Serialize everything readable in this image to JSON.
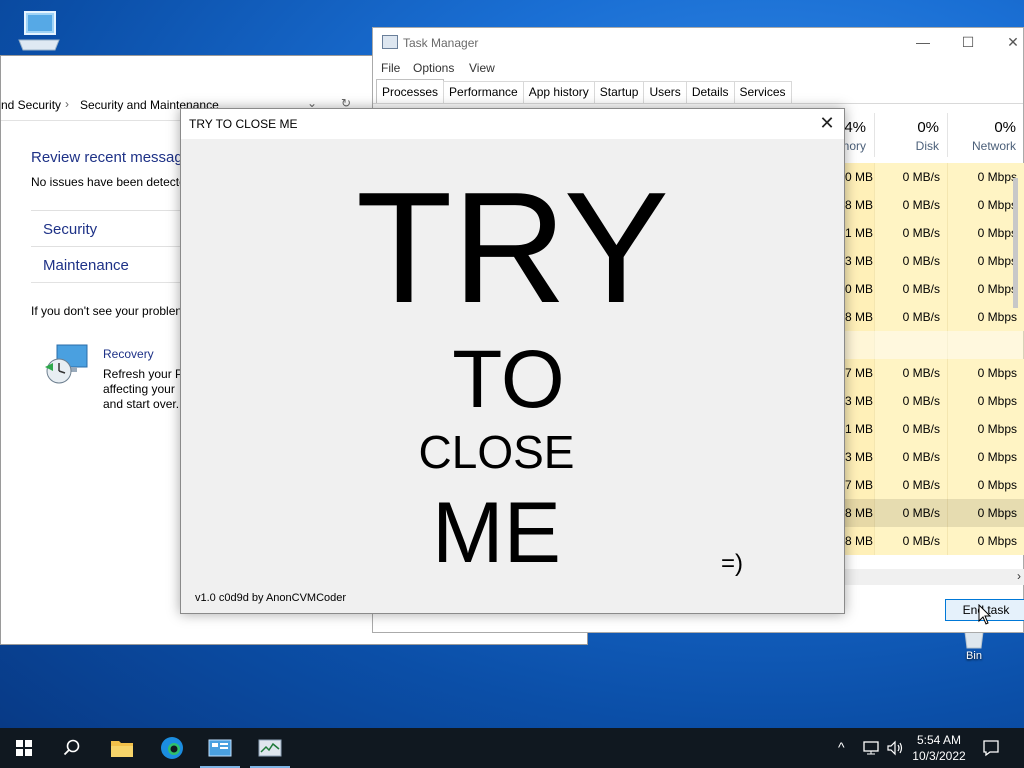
{
  "desktop": {
    "recycle_bin_label": "Bin"
  },
  "control_panel": {
    "breadcrumb": [
      "nd Security",
      "Security and Maintenance"
    ],
    "heading": "Review recent messag",
    "status": "No issues have been detecte",
    "sections": [
      "Security",
      "Maintenance"
    ],
    "note": "If you don't see your problen",
    "recovery": {
      "title": "Recovery",
      "lines": [
        "Refresh your P",
        "affecting your",
        "and start over."
      ]
    }
  },
  "task_manager": {
    "title": "Task Manager",
    "menu": [
      "File",
      "Options",
      "View"
    ],
    "tabs": [
      "Processes",
      "Performance",
      "App history",
      "Startup",
      "Users",
      "Details",
      "Services"
    ],
    "active_tab": "Processes",
    "columns": [
      {
        "pct": "4%",
        "label": "nory"
      },
      {
        "pct": "0%",
        "label": "Disk"
      },
      {
        "pct": "0%",
        "label": "Network"
      }
    ],
    "rows": [
      [
        "0 MB",
        "0 MB/s",
        "0 Mbps"
      ],
      [
        "8 MB",
        "0 MB/s",
        "0 Mbps"
      ],
      [
        "1 MB",
        "0 MB/s",
        "0 Mbps"
      ],
      [
        "3 MB",
        "0 MB/s",
        "0 Mbps"
      ],
      [
        "0 MB",
        "0 MB/s",
        "0 Mbps"
      ],
      [
        "8 MB",
        "0 MB/s",
        "0 Mbps"
      ],
      [
        "",
        "",
        ""
      ],
      [
        "7 MB",
        "0 MB/s",
        "0 Mbps"
      ],
      [
        "3 MB",
        "0 MB/s",
        "0 Mbps"
      ],
      [
        "1 MB",
        "0 MB/s",
        "0 Mbps"
      ],
      [
        "3 MB",
        "0 MB/s",
        "0 Mbps"
      ],
      [
        "7 MB",
        "0 MB/s",
        "0 Mbps"
      ],
      [
        "8 MB",
        "0 MB/s",
        "0 Mbps"
      ],
      [
        "8 MB",
        "0 MB/s",
        "0 Mbps"
      ]
    ],
    "end_task_label": "End task"
  },
  "popup": {
    "title": "TRY TO CLOSE ME",
    "words": [
      "TRY",
      "TO",
      "CLOSE",
      "ME"
    ],
    "smiley": "=)",
    "credit": "v1.0 c0d9d by AnonCVMCoder"
  },
  "taskbar": {
    "time": "5:54 AM",
    "date": "10/3/2022",
    "icons": [
      "windows-start-icon",
      "search-icon",
      "file-explorer-icon",
      "edge-icon",
      "control-panel-icon",
      "task-manager-icon"
    ],
    "tray_icons": [
      "chevron-up-icon",
      "network-icon",
      "volume-icon",
      "notifications-icon"
    ]
  }
}
